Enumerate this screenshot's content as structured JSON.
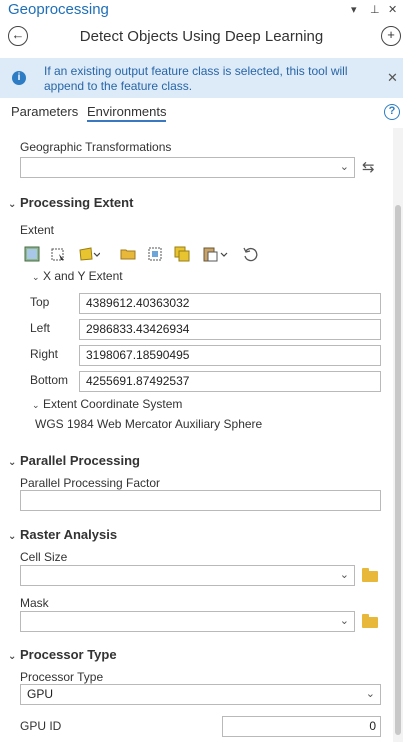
{
  "pane": {
    "title": "Geoprocessing",
    "ctrl_menu": "▾",
    "ctrl_pin": "⊥",
    "ctrl_close": "✕"
  },
  "tool": {
    "title": "Detect Objects Using Deep Learning",
    "back_glyph": "←",
    "add_glyph": "+"
  },
  "info": {
    "icon_glyph": "i",
    "message": "If an existing output feature class is selected, this tool will append to the feature class.",
    "close_glyph": "✕"
  },
  "tabs": [
    {
      "label": "Parameters",
      "active": false
    },
    {
      "label": "Environments",
      "active": true
    }
  ],
  "help_glyph": "?",
  "geo_transformations": {
    "label": "Geographic Transformations",
    "value": "",
    "swap_glyph": "⇆"
  },
  "processing_extent": {
    "header": "Processing Extent",
    "extent_label": "Extent",
    "tools": [
      "layer-extent-icon",
      "draw-extent-icon",
      "polygon-extent-icon",
      "browse-extent-icon",
      "selection-extent-icon",
      "copy-extent-icon",
      "paste-extent-icon",
      "reset-extent-icon"
    ],
    "xy_header": "X and Y Extent",
    "top_label": "Top",
    "top_value": "4389612.40363032",
    "left_label": "Left",
    "left_value": "2986833.43426934",
    "right_label": "Right",
    "right_value": "3198067.18590495",
    "bottom_label": "Bottom",
    "bottom_value": "4255691.87492537",
    "ecs_header": "Extent Coordinate System",
    "ecs_value": "WGS 1984 Web Mercator Auxiliary Sphere"
  },
  "parallel_processing": {
    "header": "Parallel Processing",
    "factor_label": "Parallel Processing Factor",
    "factor_value": ""
  },
  "raster_analysis": {
    "header": "Raster Analysis",
    "cell_size_label": "Cell Size",
    "cell_size_value": "",
    "mask_label": "Mask",
    "mask_value": ""
  },
  "processor_type": {
    "header": "Processor Type",
    "type_label": "Processor Type",
    "type_value": "GPU",
    "gpu_id_label": "GPU ID",
    "gpu_id_value": "0"
  },
  "colors": {
    "accent": "#1e6fb8",
    "info_bg": "#ddeaf7",
    "folder": "#e8b83a"
  }
}
